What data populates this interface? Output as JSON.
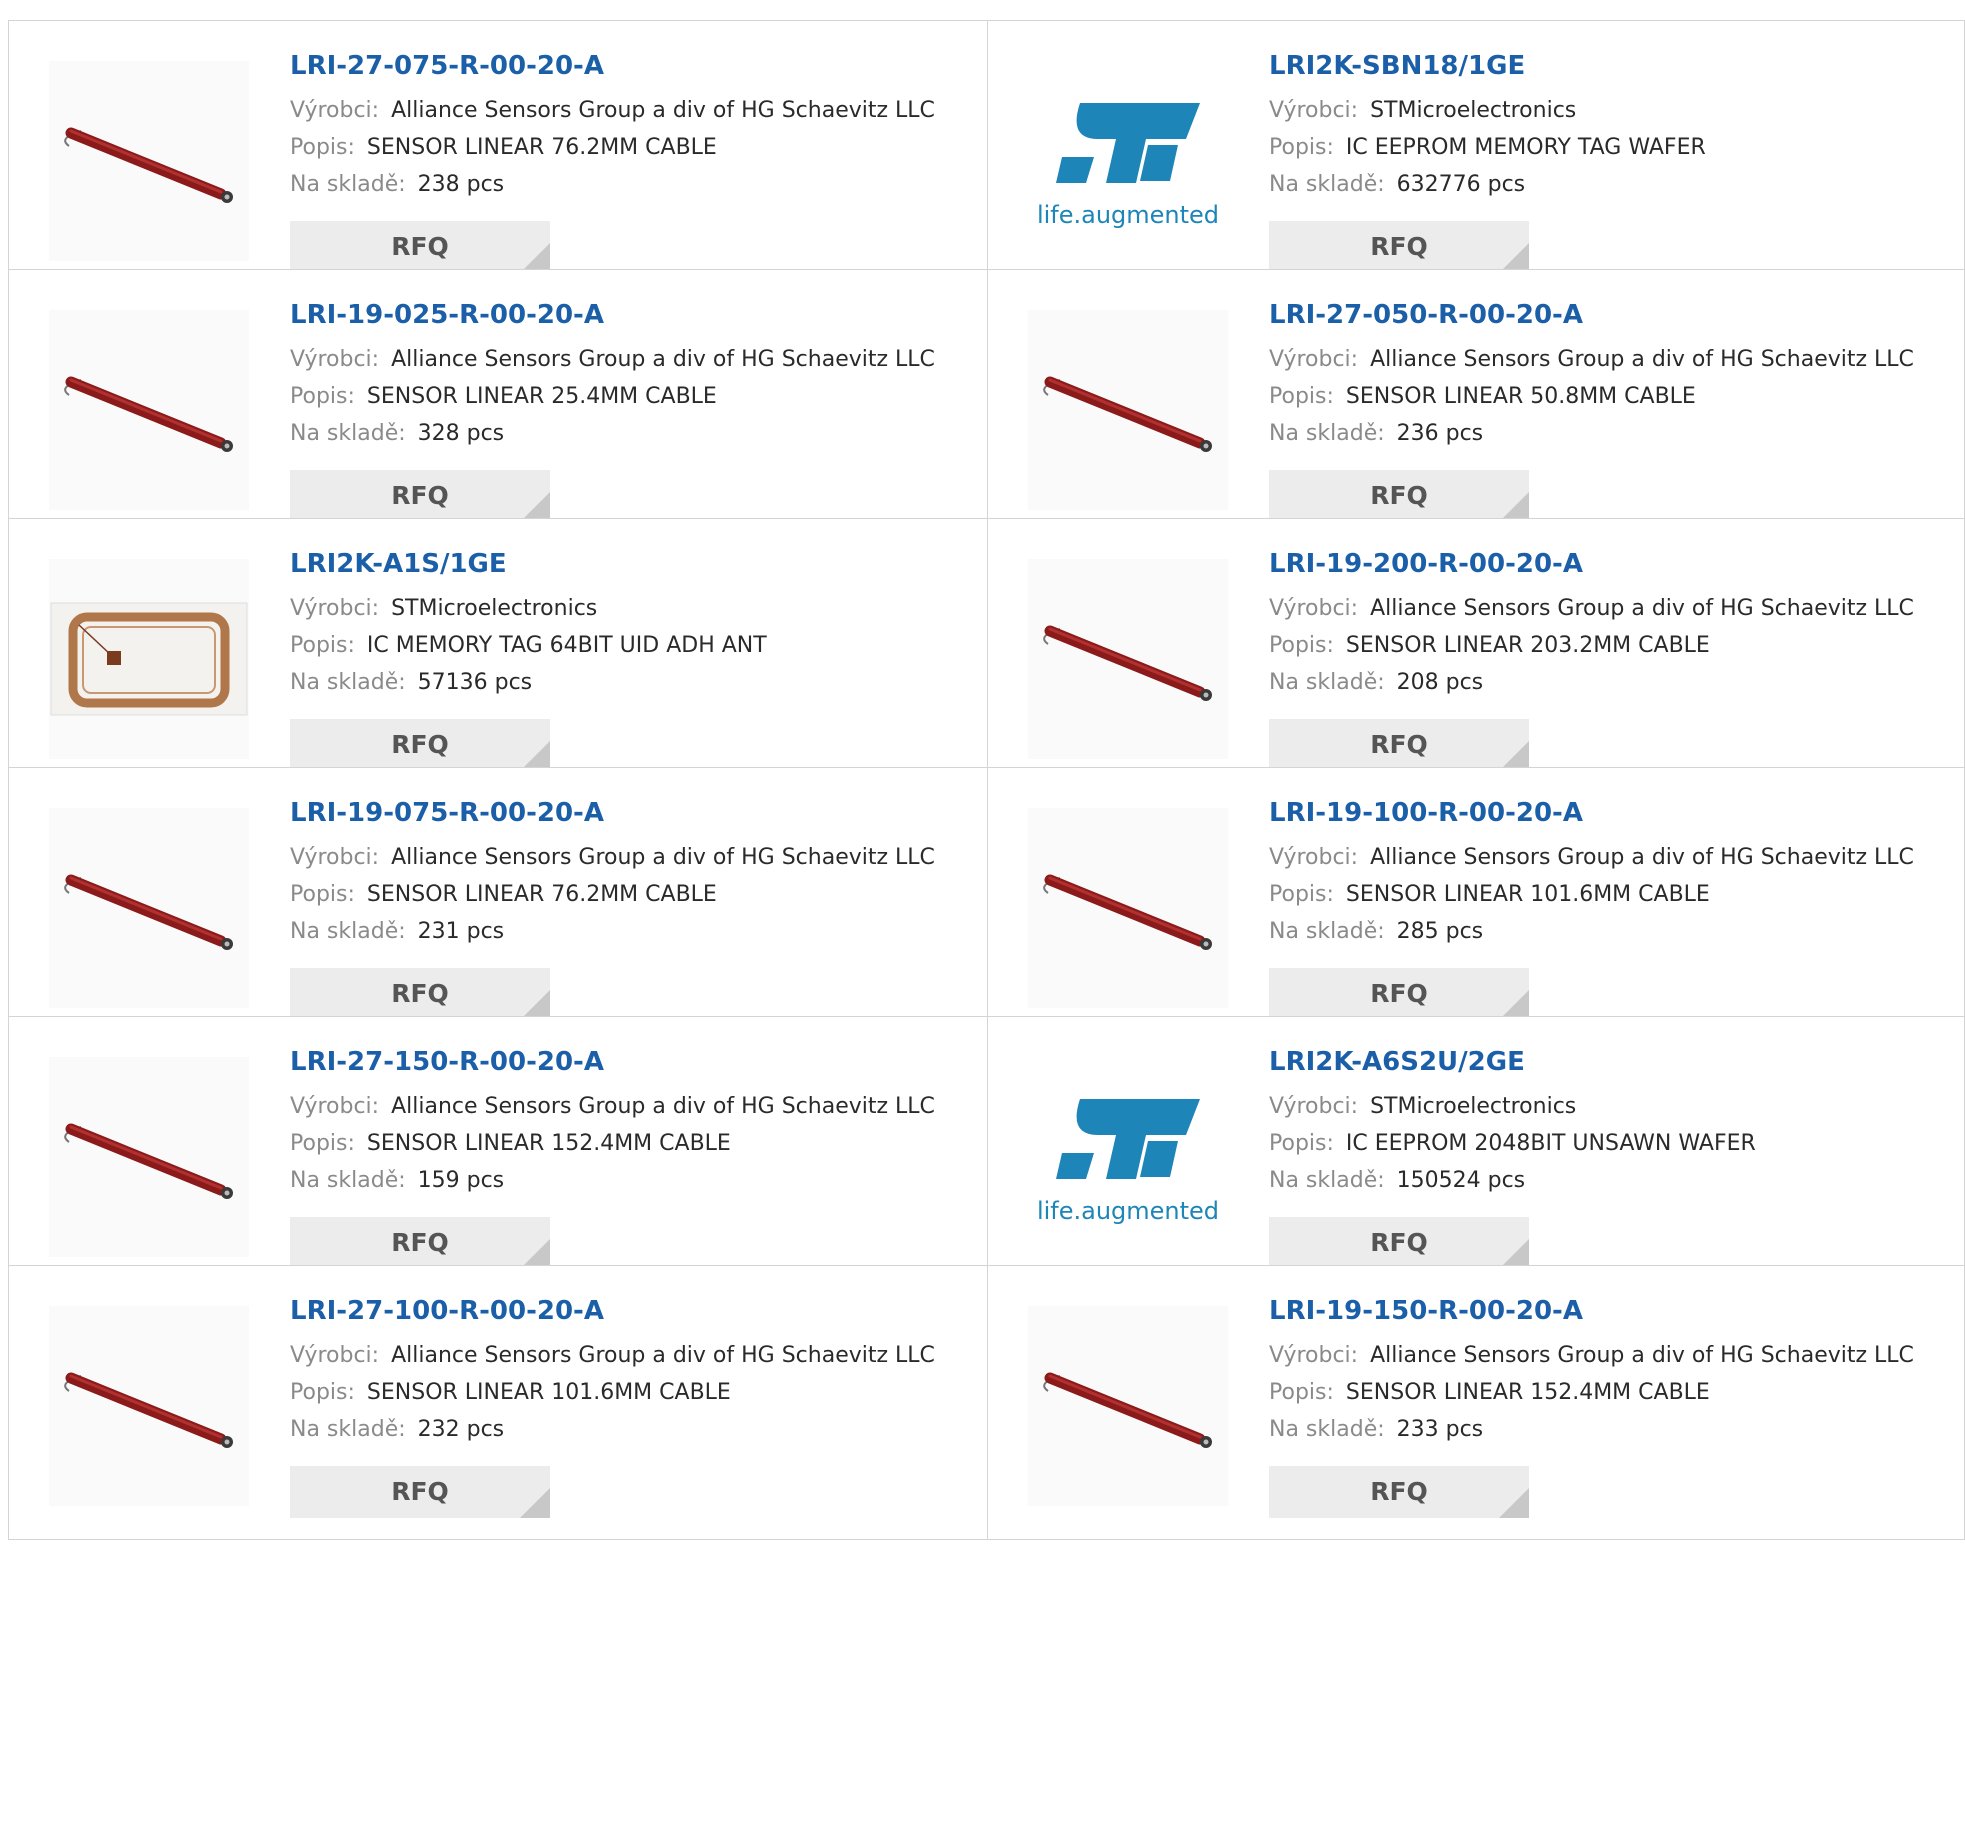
{
  "labels": {
    "manufacturer": "Výrobci:",
    "description": "Popis:",
    "stock": "Na skladě:",
    "rfq": "RFQ"
  },
  "st_logo": {
    "tagline": "life.augmented",
    "colors": {
      "mark": "#1d85b8",
      "tagline": "#1d85b8"
    }
  },
  "colors": {
    "title_link": "#1b5fa8",
    "label": "#8a8a8a",
    "value": "#2a2a2a",
    "button_bg": "#ececec",
    "button_text": "#555555",
    "sensor_body": "#8b1a1a"
  },
  "products": [
    {
      "part": "LRI-27-075-R-00-20-A",
      "manufacturer": "Alliance Sensors Group a div of HG Schaevitz LLC",
      "description": "SENSOR LINEAR 76.2MM CABLE",
      "stock": "238 pcs",
      "image": "sensor-rod"
    },
    {
      "part": "LRI2K-SBN18/1GE",
      "manufacturer": "STMicroelectronics",
      "description": "IC EEPROM MEMORY TAG WAFER",
      "stock": "632776 pcs",
      "image": "st-logo"
    },
    {
      "part": "LRI-19-025-R-00-20-A",
      "manufacturer": "Alliance Sensors Group a div of HG Schaevitz LLC",
      "description": "SENSOR LINEAR 25.4MM CABLE",
      "stock": "328 pcs",
      "image": "sensor-rod"
    },
    {
      "part": "LRI-27-050-R-00-20-A",
      "manufacturer": "Alliance Sensors Group a div of HG Schaevitz LLC",
      "description": "SENSOR LINEAR 50.8MM CABLE",
      "stock": "236 pcs",
      "image": "sensor-rod"
    },
    {
      "part": "LRI2K-A1S/1GE",
      "manufacturer": "STMicroelectronics",
      "description": "IC MEMORY TAG 64BIT UID ADH ANT",
      "stock": "57136 pcs",
      "image": "rfid-tag"
    },
    {
      "part": "LRI-19-200-R-00-20-A",
      "manufacturer": "Alliance Sensors Group a div of HG Schaevitz LLC",
      "description": "SENSOR LINEAR 203.2MM CABLE",
      "stock": "208 pcs",
      "image": "sensor-rod"
    },
    {
      "part": "LRI-19-075-R-00-20-A",
      "manufacturer": "Alliance Sensors Group a div of HG Schaevitz LLC",
      "description": "SENSOR LINEAR 76.2MM CABLE",
      "stock": "231 pcs",
      "image": "sensor-rod"
    },
    {
      "part": "LRI-19-100-R-00-20-A",
      "manufacturer": "Alliance Sensors Group a div of HG Schaevitz LLC",
      "description": "SENSOR LINEAR 101.6MM CABLE",
      "stock": "285 pcs",
      "image": "sensor-rod"
    },
    {
      "part": "LRI-27-150-R-00-20-A",
      "manufacturer": "Alliance Sensors Group a div of HG Schaevitz LLC",
      "description": "SENSOR LINEAR 152.4MM CABLE",
      "stock": "159 pcs",
      "image": "sensor-rod"
    },
    {
      "part": "LRI2K-A6S2U/2GE",
      "manufacturer": "STMicroelectronics",
      "description": "IC EEPROM 2048BIT UNSAWN WAFER",
      "stock": "150524 pcs",
      "image": "st-logo"
    },
    {
      "part": "LRI-27-100-R-00-20-A",
      "manufacturer": "Alliance Sensors Group a div of HG Schaevitz LLC",
      "description": "SENSOR LINEAR 101.6MM CABLE",
      "stock": "232 pcs",
      "image": "sensor-rod"
    },
    {
      "part": "LRI-19-150-R-00-20-A",
      "manufacturer": "Alliance Sensors Group a div of HG Schaevitz LLC",
      "description": "SENSOR LINEAR 152.4MM CABLE",
      "stock": "233 pcs",
      "image": "sensor-rod"
    }
  ]
}
